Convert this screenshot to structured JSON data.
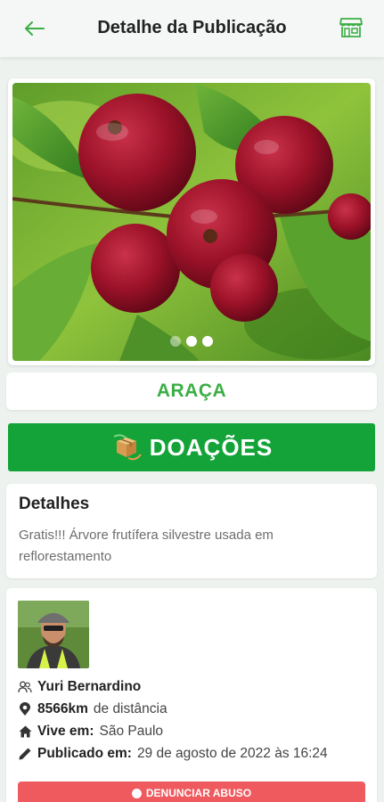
{
  "header": {
    "title": "Detalhe da Publicação",
    "back_icon": "arrow-left-icon",
    "store_icon": "store-icon",
    "accent": "#3cae45"
  },
  "carousel": {
    "dots": 3,
    "active_dot": 2
  },
  "post": {
    "title": "ARAÇA",
    "category": "DOAÇÕES",
    "category_color": "#13a338"
  },
  "details": {
    "heading": "Detalhes",
    "text": "Gratis!!! Árvore frutífera silvestre usada em reflorestamento"
  },
  "author": {
    "name": "Yuri Bernardino",
    "distance_value": "8566km",
    "distance_suffix": "de distância",
    "lives_label": "Vive em:",
    "lives_value": "São Paulo",
    "published_label": "Publicado em:",
    "published_value": "29 de agosto de 2022 às 16:24"
  },
  "report": {
    "label": "DENUNCIAR ABUSO",
    "color": "#ef5a5f"
  }
}
